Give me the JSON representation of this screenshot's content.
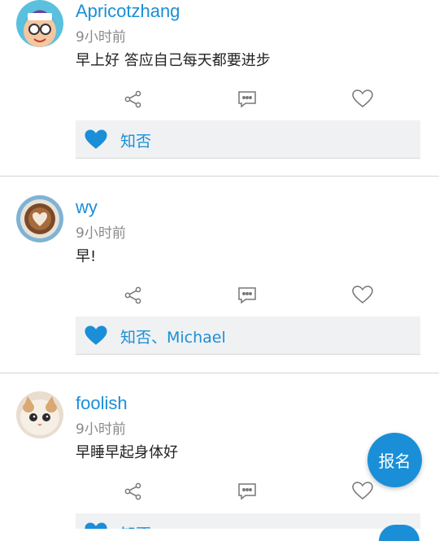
{
  "posts": [
    {
      "username": "Apricotzhang",
      "time": "9小时前",
      "content": "早上好 答应自己每天都要进步",
      "likes": "知否",
      "avatar_icon": "cartoon-girl-avatar"
    },
    {
      "username": "wy",
      "time": "9小时前",
      "content": "早!",
      "likes": "知否、Michael",
      "avatar_icon": "latte-art-avatar"
    },
    {
      "username": "foolish",
      "time": "9小时前",
      "content": "早睡早起身体好",
      "likes": "知否",
      "avatar_icon": "cat-avatar"
    }
  ],
  "fab": {
    "label": "报名"
  },
  "colors": {
    "accent": "#1a8fd8",
    "like_bar": "#f0f1f3",
    "muted": "#8a8a8a"
  }
}
